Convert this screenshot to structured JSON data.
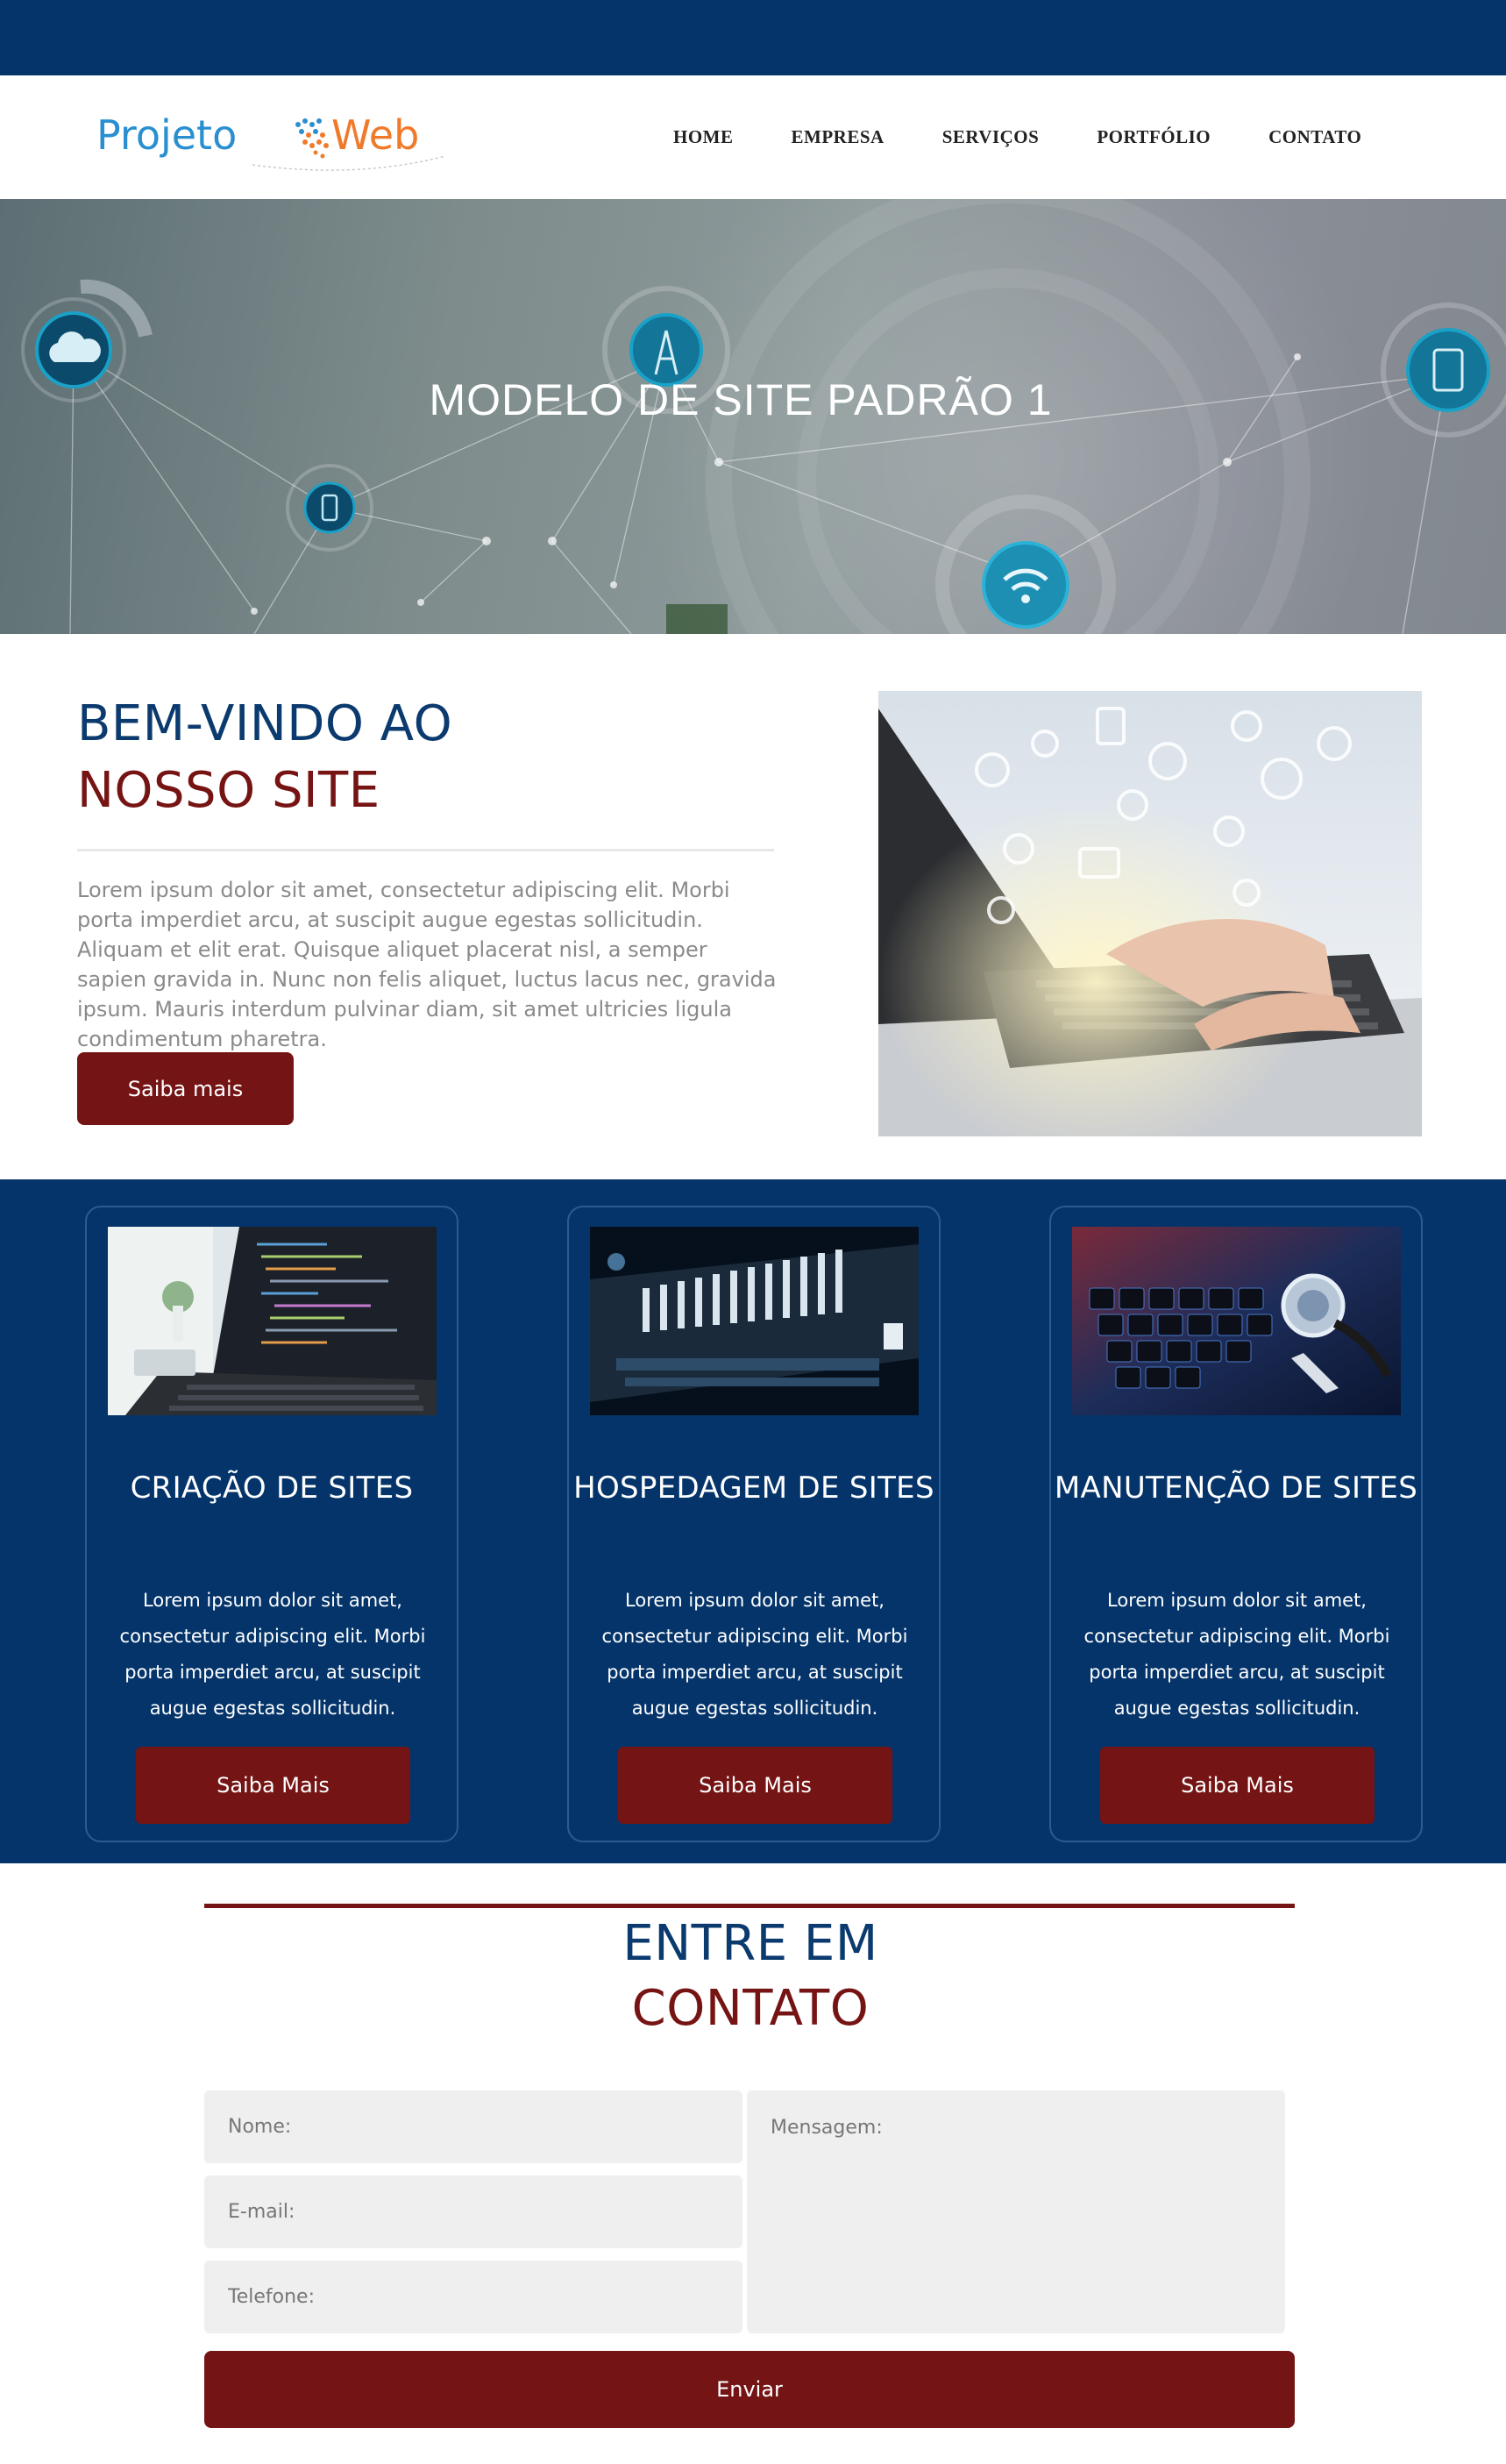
{
  "brand": {
    "logo_part1": "Projeto",
    "logo_part2": "Web",
    "colors": {
      "navy": "#04346a",
      "maroon": "#741414",
      "logo_blue": "#2a8fd0",
      "logo_orange": "#f07a2a"
    }
  },
  "nav": {
    "items": [
      {
        "label": "HOME"
      },
      {
        "label": "EMPRESA"
      },
      {
        "label": "SERVIÇOS"
      },
      {
        "label": "PORTFÓLIO"
      },
      {
        "label": "CONTATO"
      }
    ]
  },
  "hero": {
    "title": "MODELO DE SITE PADRÃO 1",
    "icons": [
      "cloud-icon",
      "signal-tower-icon",
      "tablet-icon",
      "phone-icon",
      "wifi-icon"
    ]
  },
  "welcome": {
    "title_line1": "BEM-VINDO AO",
    "title_line2": "NOSSO SITE",
    "text": "Lorem ipsum dolor sit amet, consectetur adipiscing elit. Morbi porta imperdiet arcu, at suscipit augue egestas sollicitudin. Aliquam et elit erat. Quisque aliquet placerat nisl, a semper sapien gravida in. Nunc non felis aliquet, luctus lacus nec, gravida ipsum. Mauris interdum pulvinar diam, sit amet ultricies ligula condimentum pharetra.",
    "button_label": "Saiba mais"
  },
  "services": [
    {
      "title": "CRIAÇÃO DE SITES",
      "text": "Lorem ipsum dolor sit amet, consectetur adipiscing elit. Morbi porta imperdiet arcu, at suscipit augue egestas sollicitudin.",
      "button_label": "Saiba Mais"
    },
    {
      "title": "HOSPEDAGEM DE SITES",
      "text": "Lorem ipsum dolor sit amet, consectetur adipiscing elit. Morbi porta imperdiet arcu, at suscipit augue egestas sollicitudin.",
      "button_label": "Saiba Mais"
    },
    {
      "title": "MANUTENÇÃO DE SITES",
      "text": "Lorem ipsum dolor sit amet, consectetur adipiscing elit. Morbi porta imperdiet arcu, at suscipit augue egestas sollicitudin.",
      "button_label": "Saiba Mais"
    }
  ],
  "contact": {
    "title_line1": "ENTRE EM",
    "title_line2": "CONTATO",
    "name_placeholder": "Nome:",
    "email_placeholder": "E-mail:",
    "phone_placeholder": "Telefone:",
    "message_placeholder": "Mensagem:",
    "submit_label": "Enviar"
  }
}
